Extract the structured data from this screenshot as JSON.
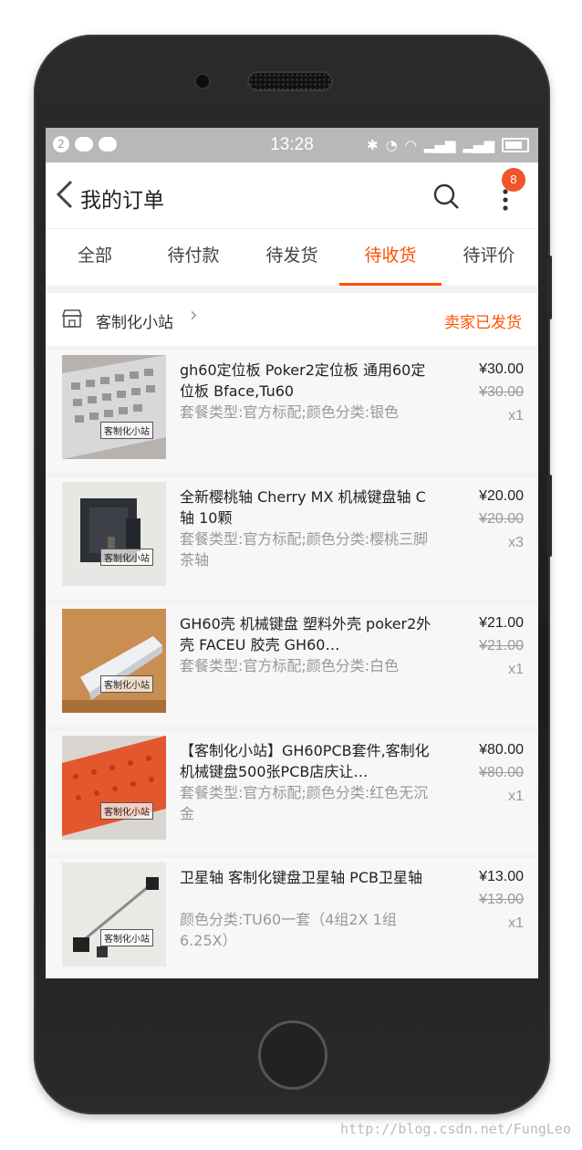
{
  "status_bar": {
    "time": "13:28",
    "notif_count": "2"
  },
  "header": {
    "title": "我的订单",
    "badge": "8"
  },
  "tabs": [
    {
      "label": "全部"
    },
    {
      "label": "待付款"
    },
    {
      "label": "待发货"
    },
    {
      "label": "待收货",
      "active": true
    },
    {
      "label": "待评价"
    }
  ],
  "shop": {
    "name": "客制化小站",
    "status": "卖家已发货"
  },
  "items": [
    {
      "title": "gh60定位板 Poker2定位板 通用60定位板 Bface,Tu60",
      "spec": "套餐类型:官方标配;颜色分类:银色",
      "price": "¥30.00",
      "orig": "¥30.00",
      "qty": "x1"
    },
    {
      "title": "全新樱桃轴 Cherry MX 机械键盘轴 C轴 10颗",
      "spec": "套餐类型:官方标配;颜色分类:樱桃三脚茶轴",
      "price": "¥20.00",
      "orig": "¥20.00",
      "qty": "x3"
    },
    {
      "title": "GH60壳 机械键盘 塑料外壳 poker2外壳 FACEU 胶壳 GH60…",
      "spec": "套餐类型:官方标配;颜色分类:白色",
      "price": "¥21.00",
      "orig": "¥21.00",
      "qty": "x1"
    },
    {
      "title": "【客制化小站】GH60PCB套件,客制化机械键盘500张PCB店庆让…",
      "spec": "套餐类型:官方标配;颜色分类:红色无沉金",
      "price": "¥80.00",
      "orig": "¥80.00",
      "qty": "x1"
    },
    {
      "title": "卫星轴 客制化键盘卫星轴 PCB卫星轴",
      "spec": "颜色分类:TU60一套（4组2X 1组6.25X）",
      "price": "¥13.00",
      "orig": "¥13.00",
      "qty": "x1"
    }
  ],
  "thumb_watermark": "客制化小站",
  "page_watermark": "http://blog.csdn.net/FungLeo"
}
